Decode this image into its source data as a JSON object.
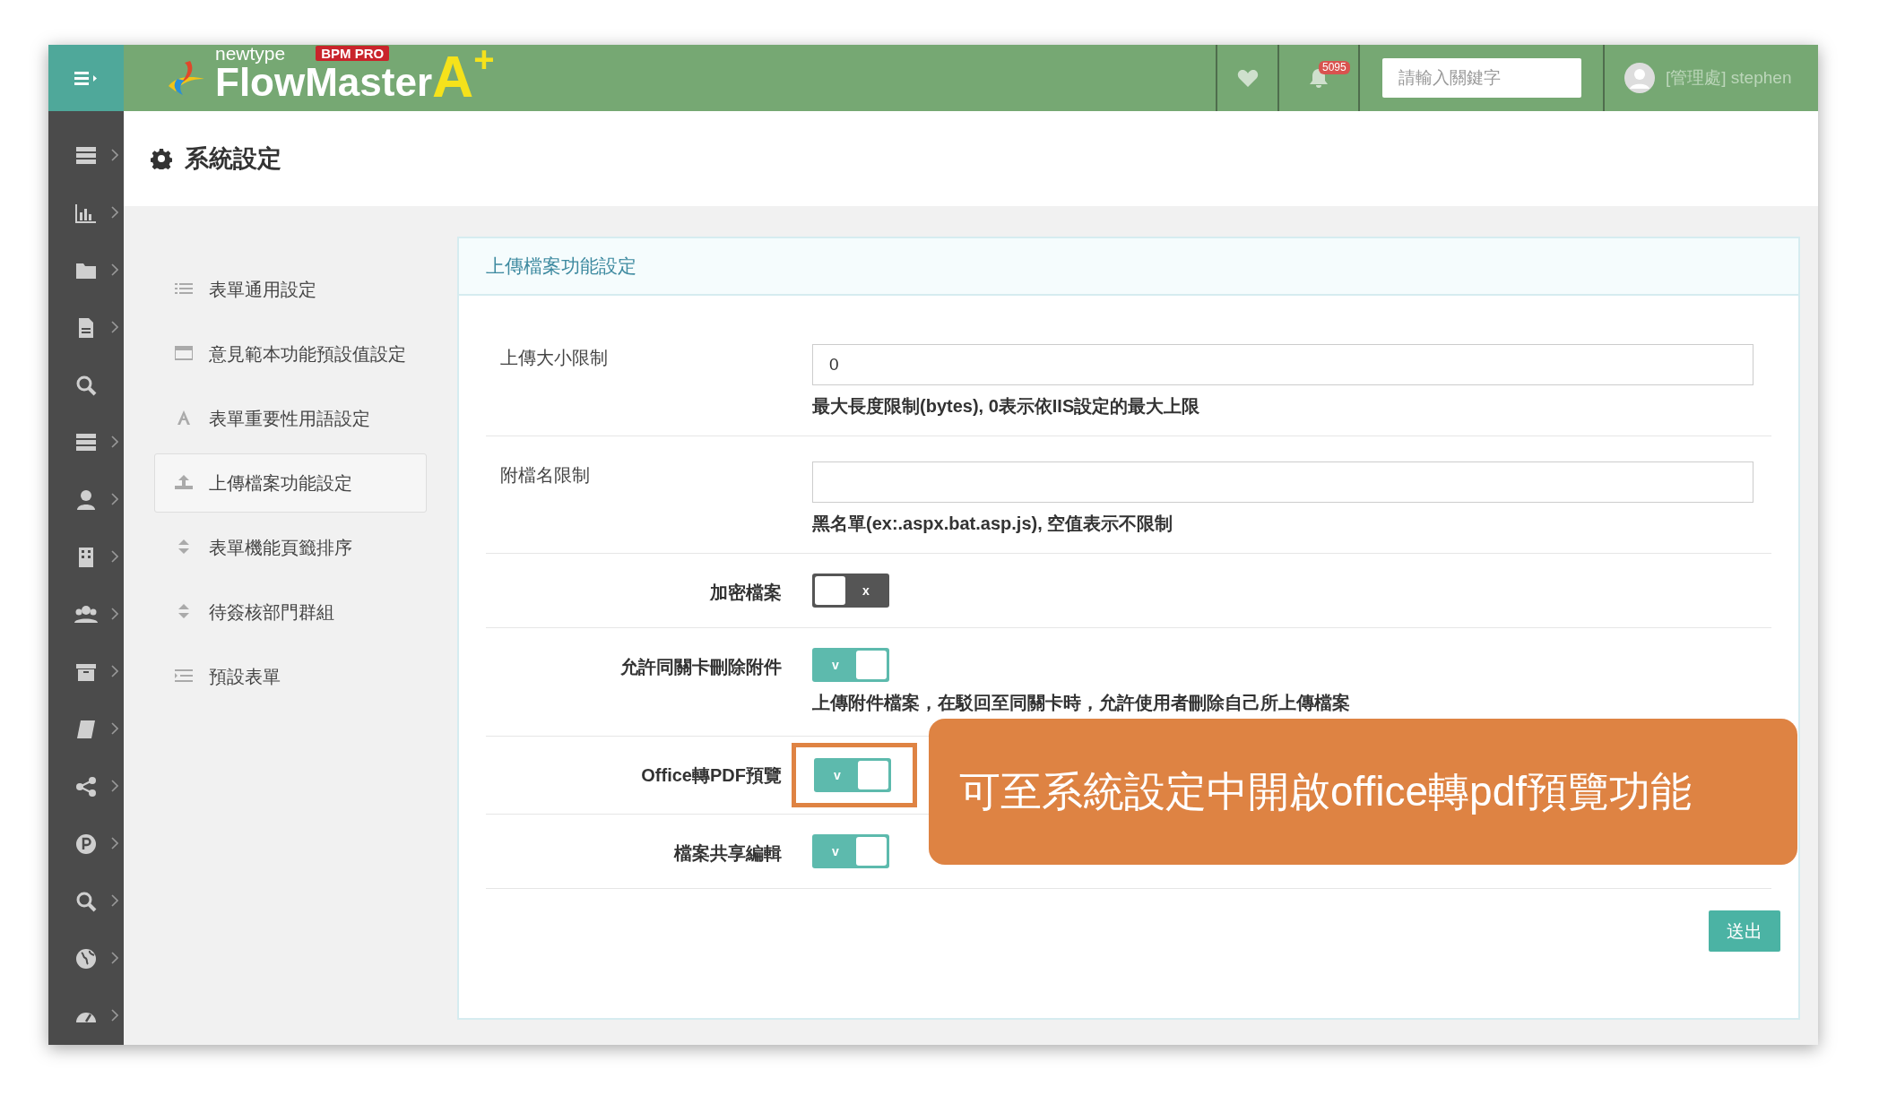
{
  "header": {
    "logo": {
      "tagline": "newtype",
      "badge": "BPM PRO",
      "name": "FlowMaster",
      "suffix": "A",
      "suffix_mark": "+"
    },
    "notification_count": "5095",
    "search": {
      "placeholder": "請輸入關鍵字"
    },
    "user": "[管理處] stephen"
  },
  "page_title": "系統設定",
  "settings_menu": [
    {
      "label": "表單通用設定",
      "selected": false
    },
    {
      "label": "意見範本功能預設值設定",
      "selected": false
    },
    {
      "label": "表單重要性用語設定",
      "selected": false
    },
    {
      "label": "上傳檔案功能設定",
      "selected": true
    },
    {
      "label": "表單機能頁籤排序",
      "selected": false
    },
    {
      "label": "待簽核部門群組",
      "selected": false
    },
    {
      "label": "預設表單",
      "selected": false
    }
  ],
  "panel": {
    "title": "上傳檔案功能設定",
    "fields": [
      {
        "kind": "text",
        "label": "上傳大小限制",
        "value": "0",
        "help": "最大長度限制(bytes), 0表示依IIS設定的最大上限"
      },
      {
        "kind": "text",
        "label": "附檔名限制",
        "help": "黑名單(ex:.aspx.bat.asp.js), 空值表示不限制"
      },
      {
        "kind": "switch",
        "label": "加密檔案",
        "on": false,
        "mark": "x"
      },
      {
        "kind": "switch",
        "label": "允許同關卡刪除附件",
        "on": true,
        "mark": "v",
        "help": "上傳附件檔案，在駁回至同關卡時，允許使用者刪除自己所上傳檔案"
      },
      {
        "kind": "switch",
        "label": "Office轉PDF預覽",
        "on": true,
        "mark": "v",
        "highlighted": true
      },
      {
        "kind": "switch",
        "label": "檔案共享編輯",
        "on": true,
        "mark": "v"
      }
    ],
    "submit": "送出"
  },
  "callout": "可至系統設定中開啟office轉pdf預覽功能"
}
